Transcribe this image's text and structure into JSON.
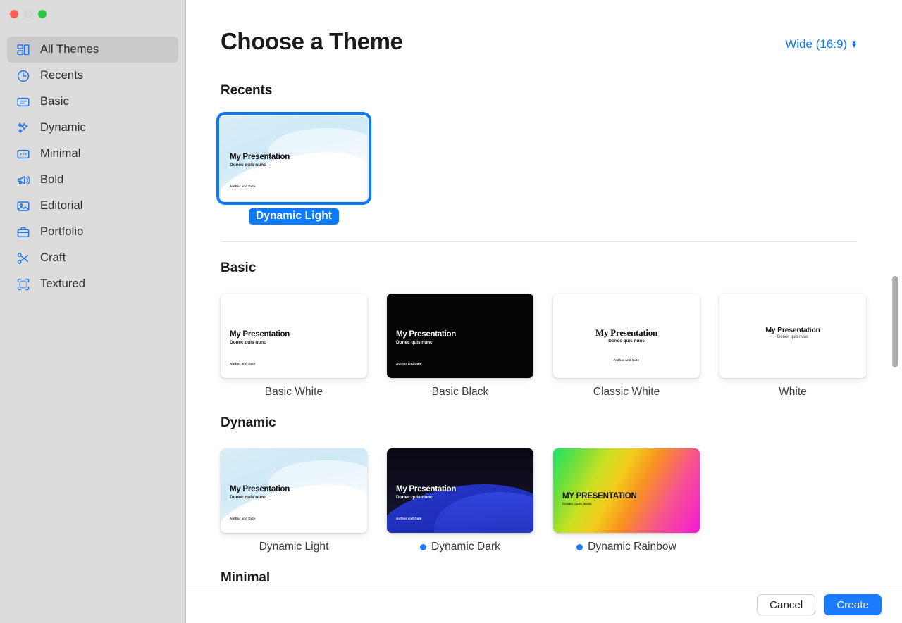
{
  "window": {
    "traffic_lights": [
      "close",
      "minimize",
      "zoom"
    ]
  },
  "sidebar": {
    "items": [
      {
        "label": "All Themes",
        "icon": "grid-icon",
        "selected": true
      },
      {
        "label": "Recents",
        "icon": "clock-icon",
        "selected": false
      },
      {
        "label": "Basic",
        "icon": "textbox-icon",
        "selected": false
      },
      {
        "label": "Dynamic",
        "icon": "sparkles-icon",
        "selected": false
      },
      {
        "label": "Minimal",
        "icon": "dots-box-icon",
        "selected": false
      },
      {
        "label": "Bold",
        "icon": "megaphone-icon",
        "selected": false
      },
      {
        "label": "Editorial",
        "icon": "photo-icon",
        "selected": false
      },
      {
        "label": "Portfolio",
        "icon": "briefcase-icon",
        "selected": false
      },
      {
        "label": "Craft",
        "icon": "scissors-icon",
        "selected": false
      },
      {
        "label": "Textured",
        "icon": "frame-icon",
        "selected": false
      }
    ]
  },
  "header": {
    "title": "Choose a Theme",
    "aspect_ratio": "Wide (16:9)"
  },
  "slide_text": {
    "title": "My Presentation",
    "subtitle": "Donec quis nunc",
    "footer": "Author and Date",
    "title_upper": "MY PRESENTATION",
    "subtitle_upper": "DONEC QUIS NUNC"
  },
  "sections": [
    {
      "title": "Recents",
      "themes": [
        {
          "name": "Dynamic Light",
          "style": "dynamic-light",
          "selected": true,
          "badge": false
        }
      ]
    },
    {
      "title": "Basic",
      "themes": [
        {
          "name": "Basic White",
          "style": "basic-white",
          "selected": false,
          "badge": false
        },
        {
          "name": "Basic Black",
          "style": "basic-black",
          "selected": false,
          "badge": false
        },
        {
          "name": "Classic White",
          "style": "classic-white",
          "selected": false,
          "badge": false
        },
        {
          "name": "White",
          "style": "white",
          "selected": false,
          "badge": false
        }
      ]
    },
    {
      "title": "Dynamic",
      "themes": [
        {
          "name": "Dynamic Light",
          "style": "dynamic-light",
          "selected": false,
          "badge": false
        },
        {
          "name": "Dynamic Dark",
          "style": "dynamic-dark",
          "selected": false,
          "badge": true
        },
        {
          "name": "Dynamic Rainbow",
          "style": "dynamic-rainbow",
          "selected": false,
          "badge": true
        }
      ]
    },
    {
      "title": "Minimal",
      "themes": []
    }
  ],
  "footer": {
    "cancel_label": "Cancel",
    "create_label": "Create"
  },
  "colors": {
    "accent": "#0a7aff",
    "create_button": "#1a7bff",
    "sidebar_bg": "#dcdcdc",
    "selected_row": "#cacaca",
    "badge_dot": "#1a7bff"
  }
}
